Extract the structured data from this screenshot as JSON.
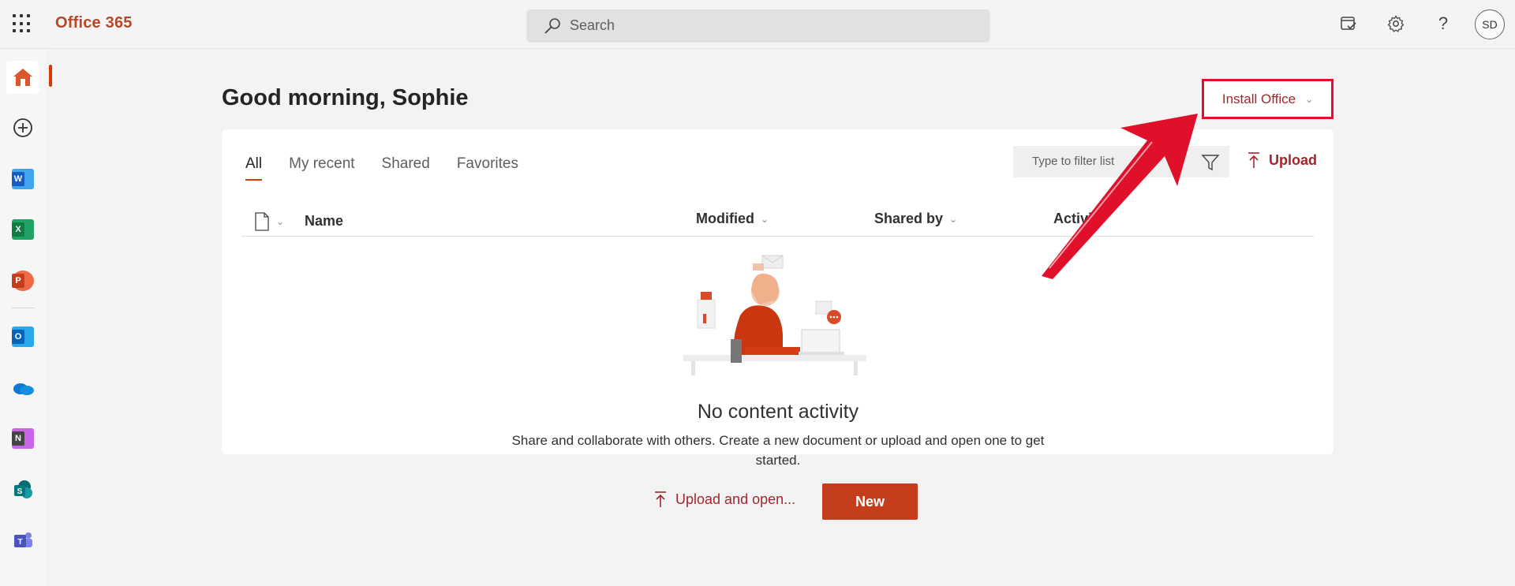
{
  "header": {
    "brand": "Office 365",
    "search_placeholder": "Search",
    "avatar_initials": "SD"
  },
  "rail": {
    "items": [
      "home",
      "create",
      "word",
      "excel",
      "powerpoint",
      "outlook",
      "onedrive",
      "onenote",
      "sharepoint",
      "teams"
    ]
  },
  "main": {
    "greeting": "Good morning, Sophie",
    "install_label": "Install Office",
    "tabs": [
      "All",
      "My recent",
      "Shared",
      "Favorites"
    ],
    "active_tab": "All",
    "filter_placeholder": "Type to filter list",
    "upload_label": "Upload",
    "columns": {
      "name": "Name",
      "modified": "Modified",
      "shared_by": "Shared by",
      "activity": "Activity"
    },
    "empty_title": "No content activity",
    "empty_desc": "Share and collaborate with others. Create a new document or upload and open one to get started.",
    "upload_open_label": "Upload and open...",
    "new_label": "New"
  },
  "colors": {
    "brand": "#b7472a",
    "accent": "#d83b01",
    "new_button": "#c43e1c",
    "annotation": "#e0102b"
  }
}
